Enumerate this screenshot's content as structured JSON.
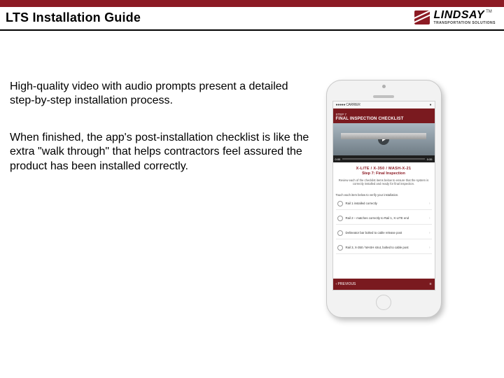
{
  "header": {
    "title": "LTS Installation Guide",
    "logo_name": "LINDSAY",
    "logo_tagline": "TRANSPORTATION SOLUTIONS",
    "tm": "TM"
  },
  "body": {
    "p1": "High-quality video with audio prompts present a detailed step-by-step installation process.",
    "p2": "When finished, the app's post-installation checklist is like the extra \"walk through\" that helps contractors feel assured the product has been installed correctly."
  },
  "phone": {
    "status": {
      "carrier": "●●●●● CARRIER",
      "battery": "●"
    },
    "app": {
      "step_label": "STEP 7",
      "screen_title": "FINAL INSPECTION CHECKLIST",
      "video": {
        "time_left": "0:00",
        "time_right": "0:35",
        "meta_code": "X-LITE / X-350 / MASH-X-21",
        "meta_title": "Step 7: Final Inspection",
        "meta_desc": "Review each of the checklist items below to ensure that the system is correctly installed and ready for final inspection."
      },
      "checklist_heading": "Touch each item below to verify your installation.",
      "items": [
        {
          "label": "Rail 1 installed correctly"
        },
        {
          "label": "Rail 2 – matches correctly to Rail 1, X-LITE end"
        },
        {
          "label": "Delineator bar bolted to cable release post"
        },
        {
          "label": "Rail 3, X-350 / MASH strut, bolted to cable post"
        }
      ],
      "footer": {
        "prev": "‹  PREVIOUS",
        "menu": "≡"
      }
    }
  }
}
